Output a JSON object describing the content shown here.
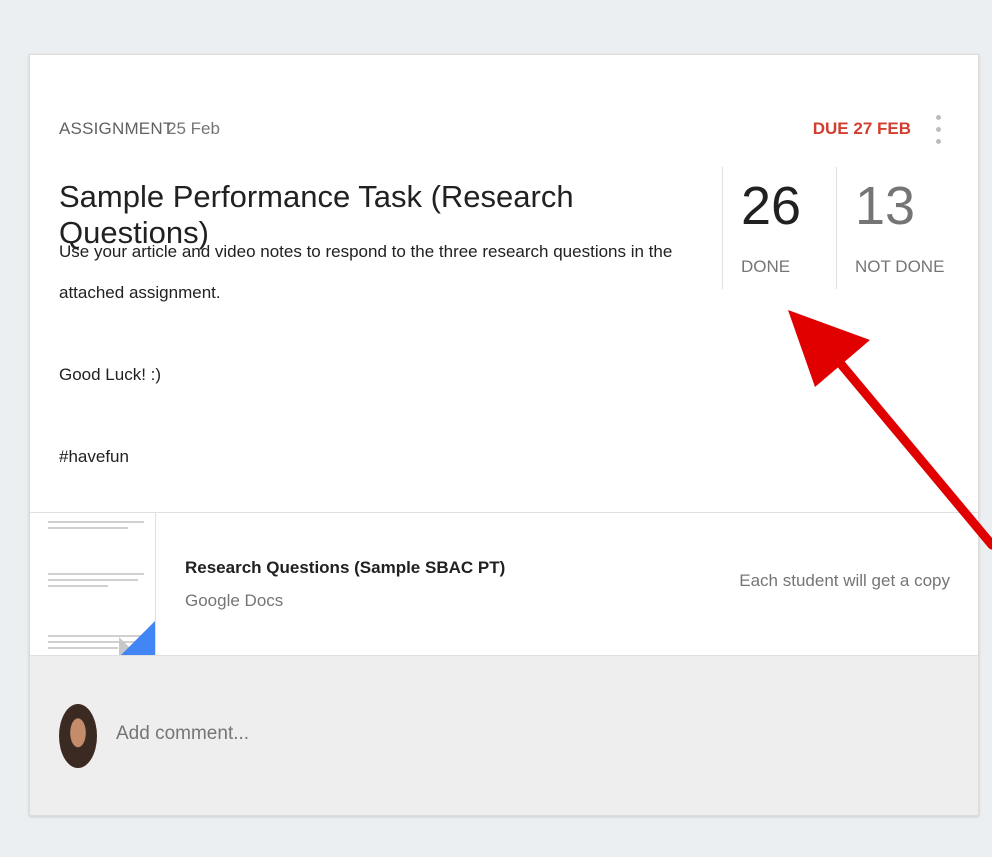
{
  "assignment": {
    "type_label": "ASSIGNMENT",
    "posted_date": "25 Feb",
    "due_label": "DUE 27 FEB",
    "title": "Sample Performance Task (Research Questions)",
    "description": [
      "Use your article and video notes to respond to the three research questions in the attached assignment.",
      "",
      "Good Luck! :)",
      "",
      "#havefun"
    ]
  },
  "stats": {
    "done": {
      "count": "26",
      "label": "DONE"
    },
    "not_done": {
      "count": "13",
      "label": "NOT DONE"
    }
  },
  "attachment": {
    "title": "Research Questions (Sample SBAC PT)",
    "source": "Google Docs",
    "mode": "Each student will get a copy",
    "icon": "google-docs-thumbnail"
  },
  "comment": {
    "placeholder": "Add comment..."
  },
  "colors": {
    "due": "#d23f31",
    "docs_blue": "#4285f4",
    "annotation_arrow": "#e00000"
  },
  "icons": {
    "more": "more-vert-icon",
    "avatar": "user-avatar"
  }
}
